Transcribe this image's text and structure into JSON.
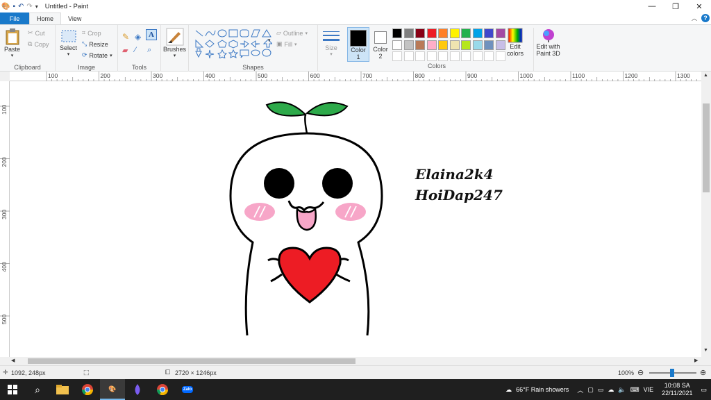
{
  "window": {
    "title": "Untitled - Paint",
    "minimize": "—",
    "restore": "❐",
    "close": "✕"
  },
  "tabs": [
    {
      "label": "File"
    },
    {
      "label": "Home"
    },
    {
      "label": "View"
    }
  ],
  "ribbon": {
    "clipboard": {
      "label": "Clipboard",
      "paste": "Paste",
      "cut": "Cut",
      "copy": "Copy"
    },
    "image": {
      "label": "Image",
      "select": "Select",
      "crop": "Crop",
      "resize": "Resize",
      "rotate": "Rotate"
    },
    "tools": {
      "label": "Tools",
      "text_icon": "A"
    },
    "brushes": {
      "label": "Brushes"
    },
    "shapes": {
      "label": "Shapes",
      "outline": "Outline",
      "fill": "Fill"
    },
    "size": {
      "label": "Size"
    },
    "color1": {
      "label": "Color",
      "num": "1"
    },
    "color2": {
      "label": "Color",
      "num": "2"
    },
    "colors": {
      "label": "Colors",
      "edit": "Edit",
      "edit2": "colors"
    },
    "paint3d": {
      "label": "Edit with",
      "label2": "Paint 3D"
    },
    "palette_row1": [
      "#000000",
      "#7f7f7f",
      "#880015",
      "#ed1c24",
      "#ff7f27",
      "#fff200",
      "#22b14c",
      "#00a2e8",
      "#3f48cc",
      "#a349a4"
    ],
    "palette_row2": [
      "#ffffff",
      "#c3c3c3",
      "#b97a57",
      "#ffaec9",
      "#ffc90e",
      "#efe4b0",
      "#b5e61d",
      "#99d9ea",
      "#7092be",
      "#c8bfe7"
    ]
  },
  "ruler_h": [
    "100",
    "200",
    "300",
    "400",
    "500",
    "600",
    "700",
    "800",
    "900",
    "1000",
    "1100",
    "1200",
    "1300"
  ],
  "ruler_v": [
    "100",
    "200",
    "300",
    "400",
    "500"
  ],
  "canvas": {
    "text1": "Elaina2k4",
    "text2": "HoiDap247"
  },
  "status": {
    "cursor": "1092, 248px",
    "size": "2720 × 1246px",
    "zoom": "100%"
  },
  "taskbar": {
    "weather": "66°F  Rain showers",
    "lang": "VIE",
    "time": "10:08 SA",
    "date": "22/11/2021",
    "zalo": "Zalo"
  }
}
